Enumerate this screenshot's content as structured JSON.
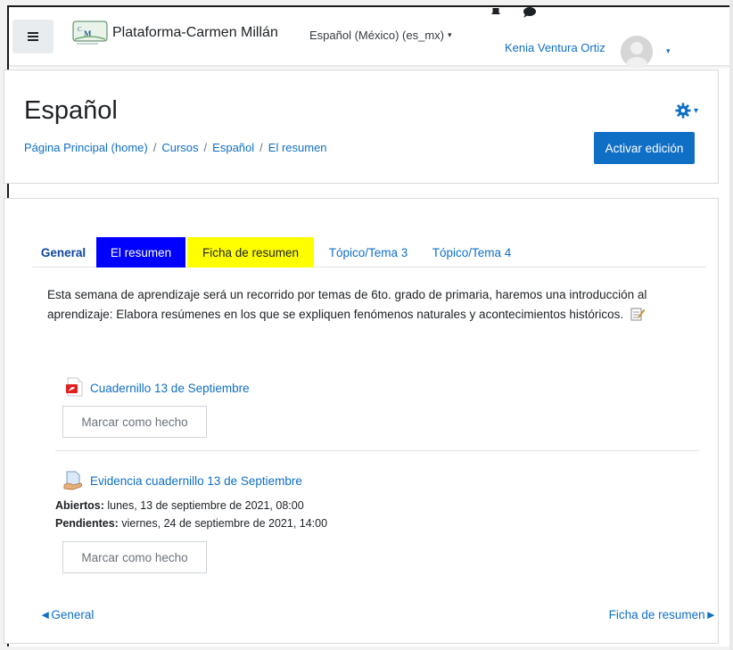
{
  "navbar": {
    "menu_icon": "hamburger-icon",
    "logo_icon": "cm-logo-icon",
    "site_name": "Plataforma-Carmen Millán",
    "language": "Español (México) (es_mx)",
    "language_caret": "▾",
    "notifications_icon": "bell-icon",
    "messages_icon": "chat-bubble-icon",
    "user_name": "Kenia Ventura Ortiz",
    "user_caret": "▾"
  },
  "header": {
    "title": "Español",
    "settings_icon": "gear-icon",
    "settings_caret": "▾",
    "breadcrumb": [
      "Página Principal (home)",
      "Cursos",
      "Español",
      "El resumen"
    ],
    "edit_button": "Activar edición"
  },
  "tabs": [
    {
      "label": "General"
    },
    {
      "label": "El resumen"
    },
    {
      "label": "Ficha de resumen"
    },
    {
      "label": "Tópico/Tema 3"
    },
    {
      "label": "Tópico/Tema 4"
    }
  ],
  "colors": {
    "accent": "#0f6fc5",
    "tab_resumen_bg": "#0000ff",
    "tab_ficha_bg": "#ffff00"
  },
  "section": {
    "summary": "Esta semana de aprendizaje será un recorrido por temas de 6to. grado de primaria, haremos una introducción al aprendizaje: Elabora resúmenes en los que se expliquen fenómenos naturales y acontecimientos históricos.",
    "summary_edit_icon": "edit-note-icon"
  },
  "activities": [
    {
      "icon": "pdf-icon",
      "title": "Cuadernillo 13 de Septiembre",
      "button": "Marcar como hecho"
    },
    {
      "icon": "assignment-icon",
      "title": "Evidencia cuadernillo 13 de Septiembre",
      "opened_label": "Abiertos:",
      "opened_value": "lunes, 13 de septiembre de 2021, 08:00",
      "due_label": "Pendientes:",
      "due_value": "viernes, 24 de septiembre de 2021, 14:00",
      "button": "Marcar como hecho"
    }
  ],
  "section_nav": {
    "prev": "◄General",
    "next": "Ficha de resumen►"
  }
}
